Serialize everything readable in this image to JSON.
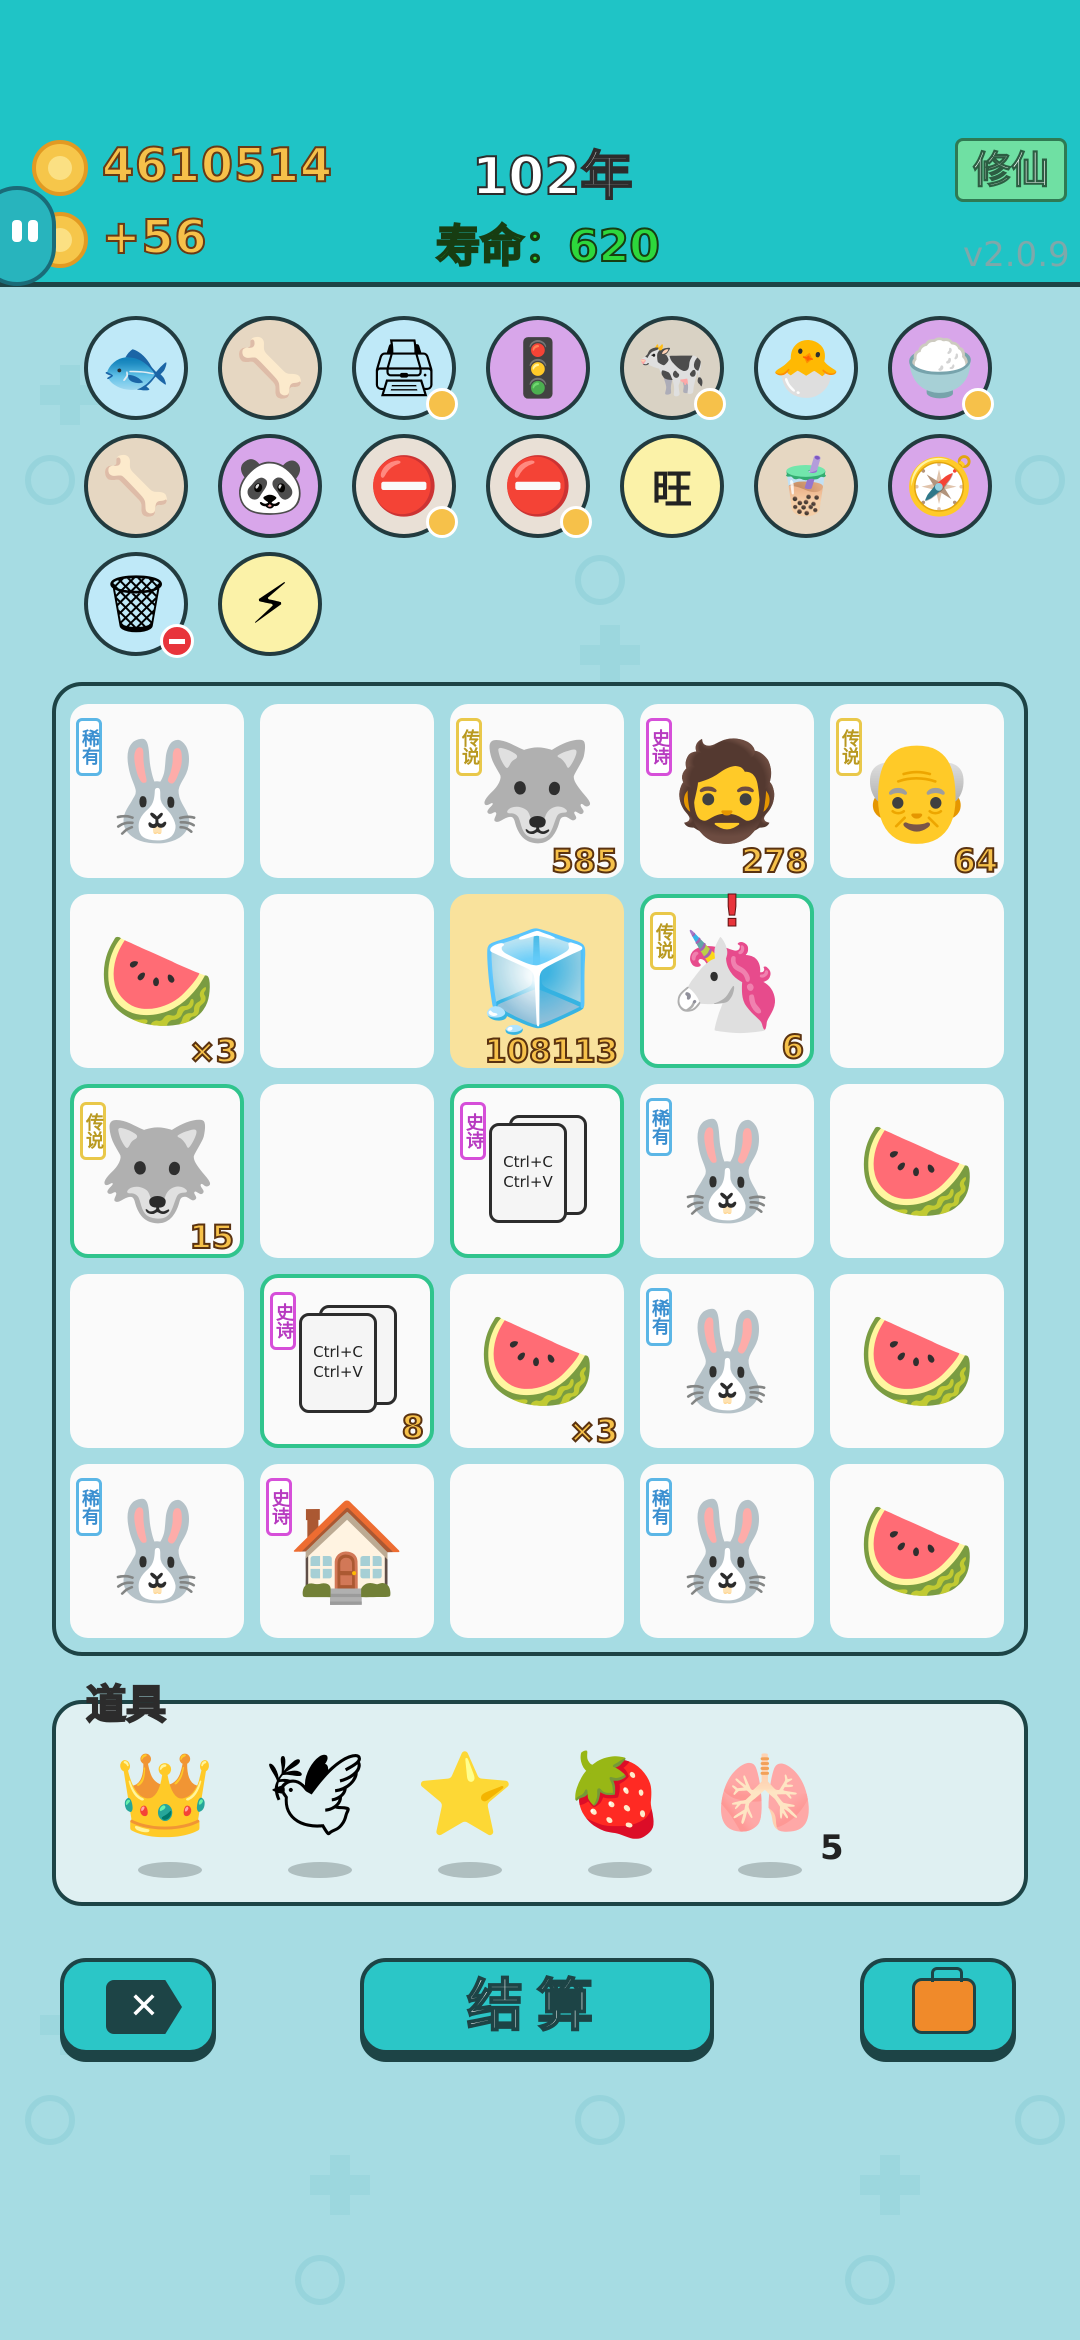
{
  "header": {
    "coins": "4610514",
    "coin_gain": "+56",
    "year": "102年",
    "life_label": "寿命：",
    "life_value": "620",
    "cultivate_button": "修仙",
    "version": "v2.0.9"
  },
  "buffs": [
    {
      "icon": "fish-bowl-icon",
      "glyph": "🐟"
    },
    {
      "icon": "pet-food-bowl-icon",
      "glyph": "🦴"
    },
    {
      "icon": "printer-icon",
      "glyph": "🖨"
    },
    {
      "icon": "traffic-light-icon",
      "glyph": "🚦"
    },
    {
      "icon": "cow-cards-icon",
      "glyph": "🐄"
    },
    {
      "icon": "chick-egg-icon",
      "glyph": "🐣"
    },
    {
      "icon": "rice-bowl-icon",
      "glyph": "🍚"
    },
    {
      "icon": "pet-food-bowl-icon",
      "glyph": "🦴"
    },
    {
      "icon": "panda-icon",
      "glyph": "🐼"
    },
    {
      "icon": "no-entry-icon",
      "glyph": "⛔"
    },
    {
      "icon": "no-entry-icon",
      "glyph": "⛔"
    },
    {
      "icon": "wang-wang-icon",
      "glyph": "旺"
    },
    {
      "icon": "bubble-tea-icon",
      "glyph": "🧋"
    },
    {
      "icon": "compass-icon",
      "glyph": "🧭"
    },
    {
      "icon": "trash-bag-icon",
      "glyph": "🗑"
    },
    {
      "icon": "lightning-icon",
      "glyph": "⚡"
    }
  ],
  "grid": [
    {
      "tag": "稀有",
      "tag_type": "rare",
      "icon": "bunny-icon",
      "glyph": "🐰",
      "num": ""
    },
    {
      "tag": "",
      "tag_type": "",
      "icon": "",
      "glyph": "",
      "num": ""
    },
    {
      "tag": "传说",
      "tag_type": "legend",
      "icon": "crowned-husky-icon",
      "glyph": "🐺",
      "num": "585"
    },
    {
      "tag": "史诗",
      "tag_type": "epic",
      "icon": "bearded-man-icon",
      "glyph": "🧔",
      "num": "278"
    },
    {
      "tag": "传说",
      "tag_type": "legend",
      "icon": "bald-grandpa-icon",
      "glyph": "👴",
      "num": "64"
    },
    {
      "tag": "",
      "tag_type": "",
      "icon": "watermelon-icon",
      "glyph": "🍉",
      "num": "×3"
    },
    {
      "tag": "",
      "tag_type": "",
      "icon": "",
      "glyph": "",
      "num": ""
    },
    {
      "tag": "",
      "tag_type": "",
      "icon": "fridge-icon",
      "glyph": "🧊",
      "num": "108113"
    },
    {
      "tag": "传说",
      "tag_type": "legend",
      "icon": "unicorn-icon",
      "glyph": "🦄",
      "num": "6",
      "alert": "!"
    },
    {
      "tag": "",
      "tag_type": "",
      "icon": "",
      "glyph": "",
      "num": ""
    },
    {
      "tag": "传说",
      "tag_type": "legend",
      "icon": "crowned-husky-icon",
      "glyph": "🐺",
      "num": "15"
    },
    {
      "tag": "",
      "tag_type": "",
      "icon": "",
      "glyph": "",
      "num": ""
    },
    {
      "tag": "史诗",
      "tag_type": "epic",
      "icon": "copy-paste-card-icon",
      "glyph": "",
      "card_text": "Ctrl+C\nCtrl+V",
      "num": ""
    },
    {
      "tag": "稀有",
      "tag_type": "rare",
      "icon": "bunny-icon",
      "glyph": "🐰",
      "num": ""
    },
    {
      "tag": "",
      "tag_type": "",
      "icon": "watermelon-icon",
      "glyph": "🍉",
      "num": ""
    },
    {
      "tag": "",
      "tag_type": "",
      "icon": "",
      "glyph": "",
      "num": ""
    },
    {
      "tag": "史诗",
      "tag_type": "epic",
      "icon": "copy-paste-card-icon",
      "glyph": "",
      "card_text": "Ctrl+C\nCtrl+V",
      "num": "8"
    },
    {
      "tag": "",
      "tag_type": "",
      "icon": "watermelon-icon",
      "glyph": "🍉",
      "num": "×3"
    },
    {
      "tag": "稀有",
      "tag_type": "rare",
      "icon": "bunny-icon",
      "glyph": "🐰",
      "num": ""
    },
    {
      "tag": "",
      "tag_type": "",
      "icon": "watermelon-icon",
      "glyph": "🍉",
      "num": ""
    },
    {
      "tag": "稀有",
      "tag_type": "rare",
      "icon": "bunny-icon",
      "glyph": "🐰",
      "num": ""
    },
    {
      "tag": "史诗",
      "tag_type": "epic",
      "icon": "bunny-house-icon",
      "glyph": "🏠",
      "num": ""
    },
    {
      "tag": "",
      "tag_type": "",
      "icon": "",
      "glyph": "",
      "num": ""
    },
    {
      "tag": "稀有",
      "tag_type": "rare",
      "icon": "bunny-icon",
      "glyph": "🐰",
      "num": ""
    },
    {
      "tag": "",
      "tag_type": "",
      "icon": "watermelon-icon",
      "glyph": "🍉",
      "num": ""
    }
  ],
  "items_panel": {
    "label": "道具",
    "items": [
      {
        "icon": "crown-icon",
        "glyph": "👑",
        "count": ""
      },
      {
        "icon": "white-bird-icon",
        "glyph": "🕊",
        "count": ""
      },
      {
        "icon": "star-icon",
        "glyph": "⭐",
        "count": ""
      },
      {
        "icon": "bayberry-icon",
        "glyph": "🍓",
        "count": ""
      },
      {
        "icon": "liver-icon",
        "glyph": "🫁",
        "count": "5"
      }
    ]
  },
  "buttons": {
    "close": "✕",
    "settle": "结算",
    "bag_icon": "briefcase-icon"
  }
}
